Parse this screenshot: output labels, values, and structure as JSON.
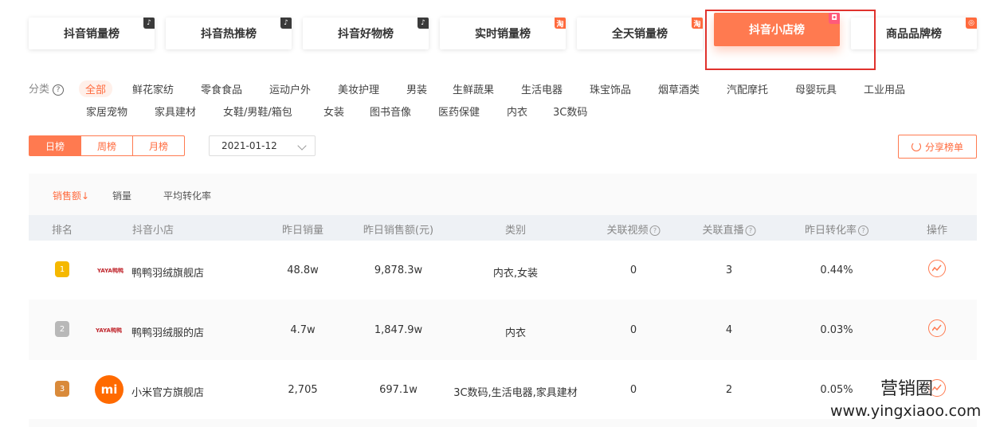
{
  "rank_tabs": [
    {
      "label": "抖音销量榜",
      "corner": "♪"
    },
    {
      "label": "抖音热推榜",
      "corner": "♪"
    },
    {
      "label": "抖音好物榜",
      "corner": "♪"
    },
    {
      "label": "实时销量榜",
      "corner": "淘"
    },
    {
      "label": "全天销量榜",
      "corner": "淘"
    },
    {
      "label": "抖音小店榜",
      "corner": "◘"
    },
    {
      "label": "商品品牌榜",
      "corner": "◎"
    }
  ],
  "category": {
    "label": "分类",
    "items": [
      "全部",
      "鲜花家纺",
      "零食食品",
      "运动户外",
      "美妆护理",
      "男装",
      "生鲜蔬果",
      "生活电器",
      "珠宝饰品",
      "烟草酒类",
      "汽配摩托",
      "母婴玩具",
      "工业用品",
      "家居宠物",
      "家具建材",
      "女鞋/男鞋/箱包",
      "女装",
      "图书音像",
      "医药保健",
      "内衣",
      "3C数码"
    ]
  },
  "period_tabs": [
    "日榜",
    "周榜",
    "月榜"
  ],
  "date_value": "2021-01-12",
  "share_label": "分享榜单",
  "sort_tabs": [
    "销售额↓",
    "销量",
    "平均转化率"
  ],
  "table": {
    "headers": [
      "排名",
      "抖音小店",
      "昨日销量",
      "昨日销售额(元)",
      "类别",
      "关联视频",
      "关联直播",
      "昨日转化率",
      "操作"
    ],
    "rows": [
      {
        "rank": "1",
        "logo": "YAYA鸭鸭",
        "shop": "鸭鸭羽绒旗舰店",
        "sales": "48.8w",
        "amount": "9,878.3w",
        "category": "内衣,女装",
        "videos": "0",
        "lives": "3",
        "rate": "0.44%"
      },
      {
        "rank": "2",
        "logo": "YAYA鸭鸭",
        "shop": "鸭鸭羽绒服的店",
        "sales": "4.7w",
        "amount": "1,847.9w",
        "category": "内衣",
        "videos": "0",
        "lives": "4",
        "rate": "0.03%"
      },
      {
        "rank": "3",
        "logo": "mi",
        "shop": "小米官方旗舰店",
        "sales": "2,705",
        "amount": "697.1w",
        "category": "3C数码,生活电器,家具建材",
        "videos": "0",
        "lives": "2",
        "rate": "0.05%"
      }
    ]
  },
  "watermark": {
    "line1": "营销圈",
    "line2": "www.yingxiaoo.com"
  },
  "colors": {
    "accent": "#ff7a50",
    "highlight_border": "#e0322d",
    "gold": "#f5b800",
    "silver": "#b8b8b8",
    "bronze": "#d98a3a",
    "mi_orange": "#ff6a00"
  }
}
